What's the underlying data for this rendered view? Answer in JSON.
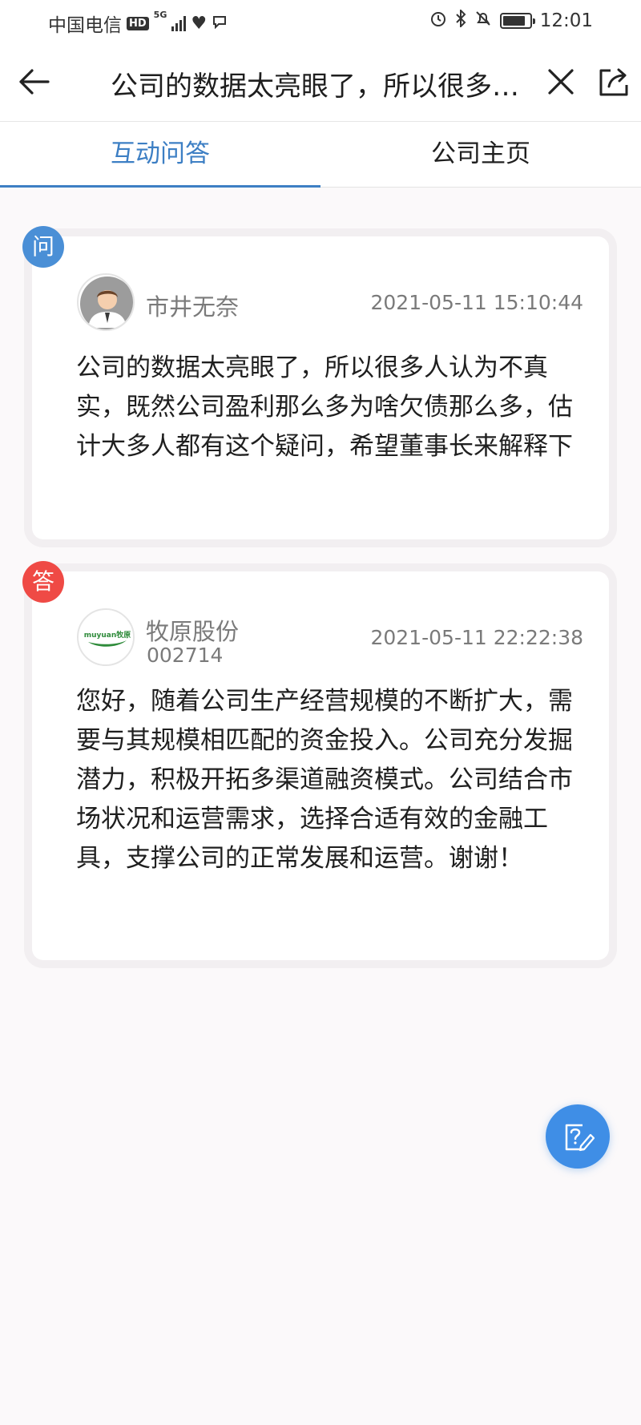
{
  "status_bar": {
    "carrier": "中国电信",
    "hd_badge": "HD",
    "network": "5G",
    "time": "12:01"
  },
  "header": {
    "title": "公司的数据太亮眼了，所以很多人认为不真实，既然公司盈利那么多为啥欠债那么多，估计大多人都有这个疑问，希望董事长来解释下"
  },
  "tabs": [
    {
      "label": "互动问答",
      "active": true
    },
    {
      "label": "公司主页",
      "active": false
    }
  ],
  "question": {
    "tag": "问",
    "author": "市井无奈",
    "time": "2021-05-11 15:10:44",
    "text": "公司的数据太亮眼了，所以很多人认为不真实，既然公司盈利那么多为啥欠债那么多，估计大多人都有这个疑问，希望董事长来解释下"
  },
  "answer": {
    "tag": "答",
    "author": "牧原股份",
    "code": "002714",
    "time": "2021-05-11 22:22:38",
    "text": "您好，随着公司生产经营规模的不断扩大，需要与其规模相匹配的资金投入。公司充分发掘潜力，积极开拓多渠道融资模式。公司结合市场状况和运营需求，选择合适有效的金融工具，支撑公司的正常发展和运营。谢谢！",
    "logo_text": "muyuan牧原"
  },
  "colors": {
    "accent": "#3d7fc4",
    "question_tag": "#4a8fd6",
    "answer_tag": "#ef4a45",
    "fab": "#3f8ee6"
  },
  "icons": {
    "back": "arrow-left-icon",
    "close": "close-icon",
    "share": "share-icon",
    "fab": "ask-question-icon"
  }
}
